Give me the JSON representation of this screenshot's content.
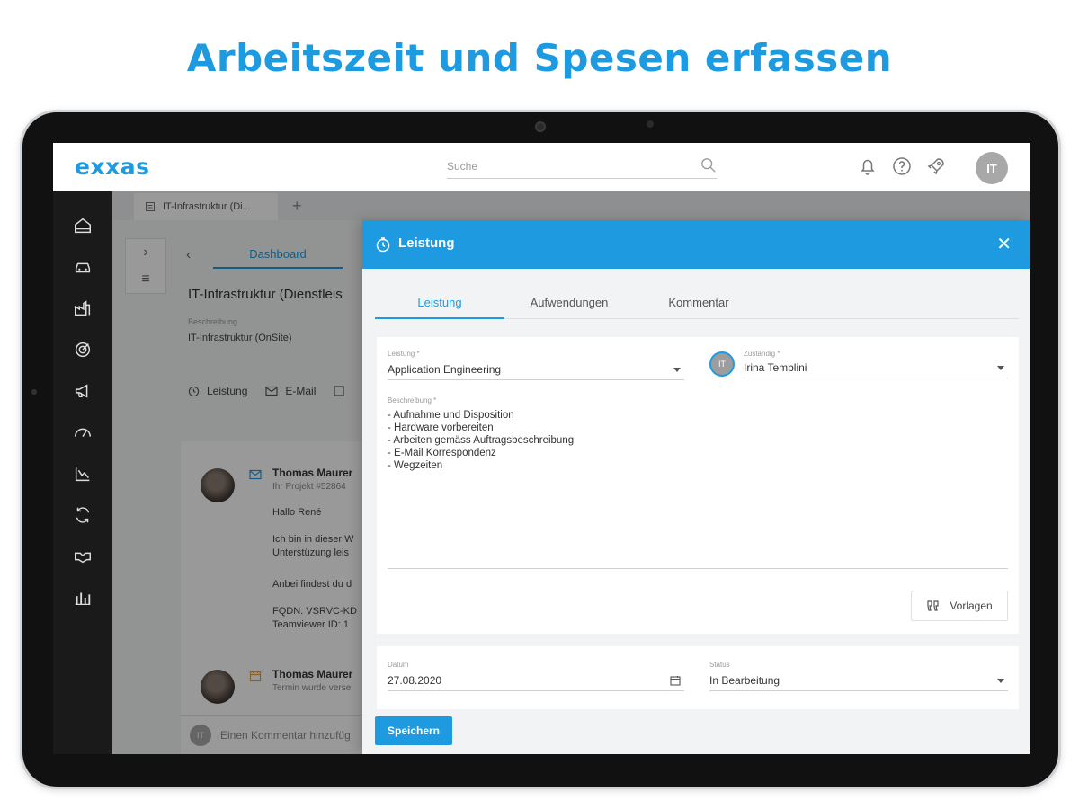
{
  "headline": "Arbeitszeit und Spesen erfassen",
  "app": {
    "logo": "exxas",
    "search_placeholder": "Suche",
    "user_initials": "IT",
    "accent_color": "#1e9be0"
  },
  "topbar_icons": [
    "bell-icon",
    "help-icon",
    "rocket-icon"
  ],
  "sidebar": {
    "items": [
      "home-icon",
      "car-icon",
      "factory-icon",
      "target-icon",
      "megaphone-icon",
      "speedometer-icon",
      "chart-trend-icon",
      "sync-icon",
      "handshake-icon",
      "bar-chart-icon"
    ]
  },
  "tabs": {
    "doc_tab": "IT-Infrastruktur (Di...",
    "add_tab": "+"
  },
  "project": {
    "breadcrumb": "Dashboard",
    "title": "IT-Infrastruktur (Dienstleis",
    "desc_label": "Beschreibung",
    "desc_value": "IT-Infrastruktur (OnSite)",
    "actions": [
      {
        "label": "Leistung"
      },
      {
        "label": "E-Mail"
      }
    ]
  },
  "feed": {
    "entry1": {
      "name": "Thomas Maurer",
      "sub": "Ihr Projekt #52864",
      "lines": [
        "Hallo René",
        "Ich bin in dieser W",
        "Unterstüzung leis",
        "Anbei findest du d",
        "FQDN: VSRVC-KD",
        "Teamviewer ID: 1"
      ]
    },
    "entry2": {
      "name": "Thomas Maurer",
      "sub": "Termin wurde verse"
    },
    "comment_placeholder": "Einen Kommentar hinzufüg",
    "comment_avatar": "IT"
  },
  "dialog": {
    "title": "Leistung",
    "tabs": [
      "Leistung",
      "Aufwendungen",
      "Kommentar"
    ],
    "active_tab": "Leistung",
    "fields": {
      "leistung_label": "Leistung *",
      "leistung_value": "Application Engineering",
      "zustaendig_label": "Zuständig *",
      "zustaendig_value": "Irina Temblini",
      "owner_initials": "IT",
      "beschreibung_label": "Beschreibung *",
      "beschreibung_value": "- Aufnahme und Disposition\n- Hardware vorbereiten\n- Arbeiten gemäss Auftragsbeschreibung\n- E-Mail Korrespondenz\n- Wegzeiten",
      "vorlagen_label": "Vorlagen",
      "datum_label": "Datum",
      "datum_value": "27.08.2020",
      "status_label": "Status",
      "status_value": "In Bearbeitung"
    },
    "save_label": "Speichern"
  }
}
